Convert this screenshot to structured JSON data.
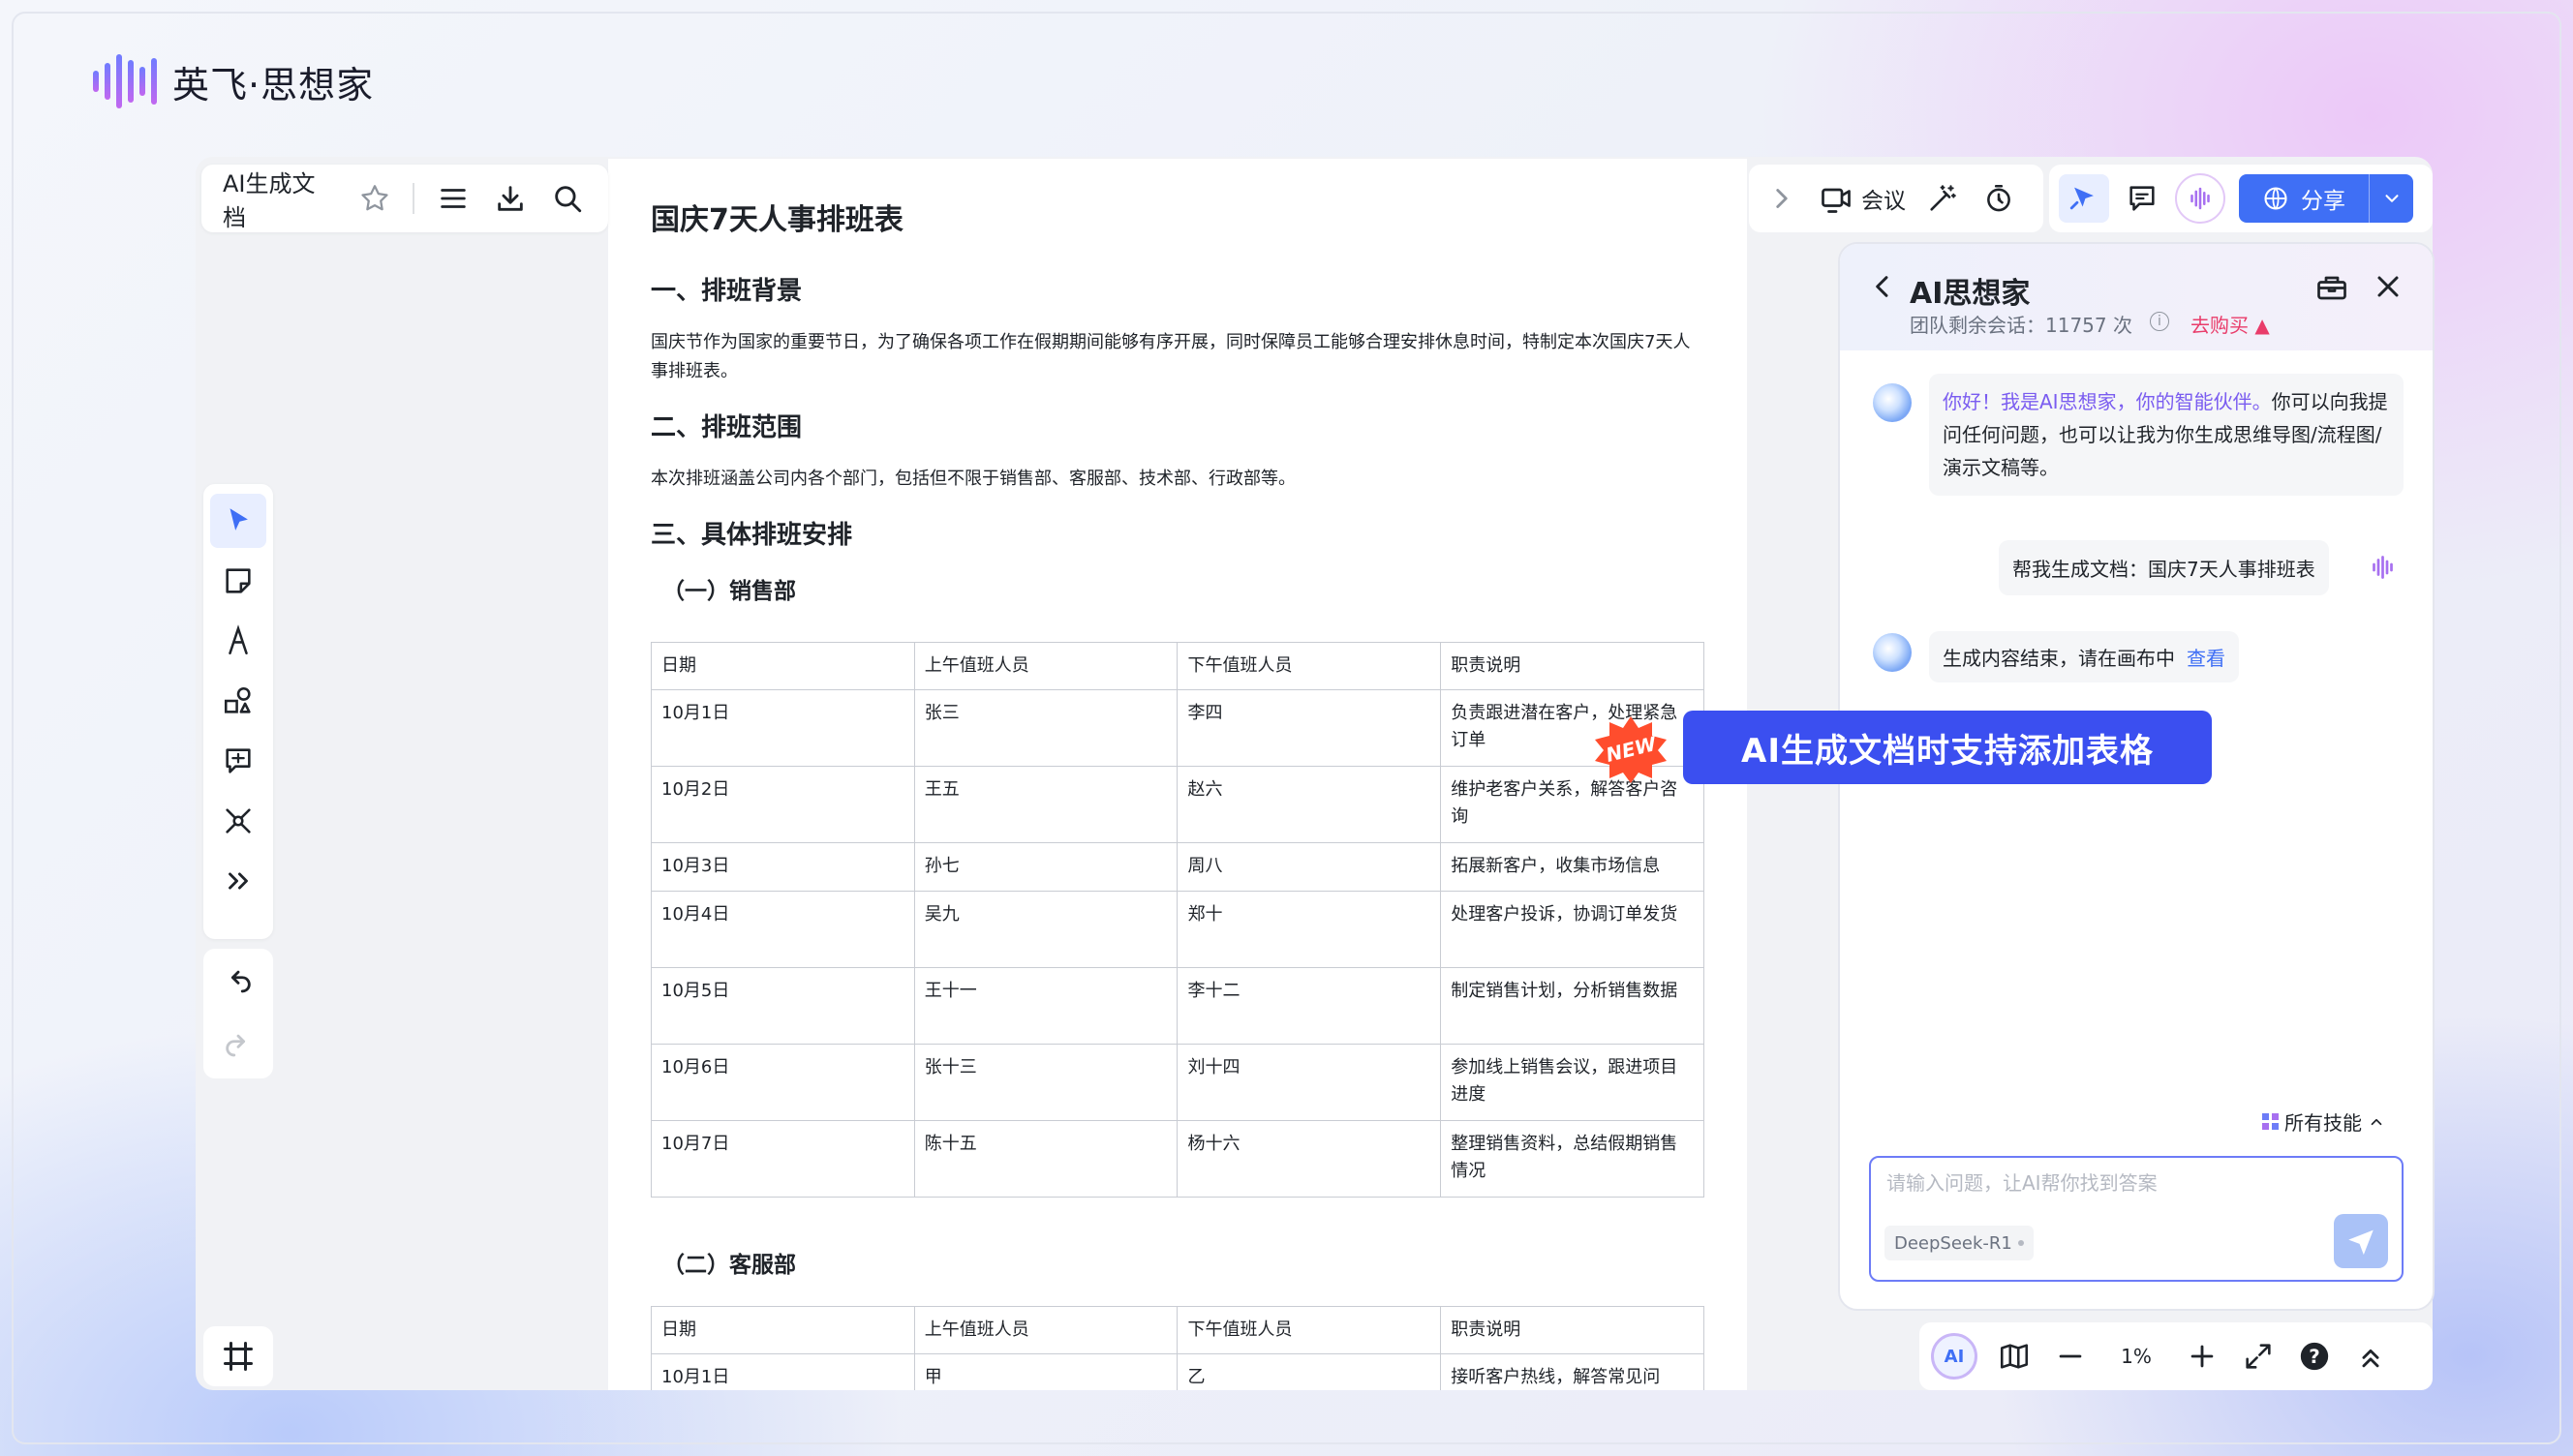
{
  "app": {
    "brand": "英飞·思想家"
  },
  "toolbar_left": {
    "title": "AI生成文档"
  },
  "toolbar_right": {
    "meeting_label": "会议",
    "share_label": "分享"
  },
  "document": {
    "title": "国庆7天人事排班表",
    "sections": [
      {
        "heading": "一、排班背景",
        "body": "国庆节作为国家的重要节日，为了确保各项工作在假期期间能够有序开展，同时保障员工能够合理安排休息时间，特制定本次国庆7天人事排班表。"
      },
      {
        "heading": "二、排班范围",
        "body": "本次排班涵盖公司内各个部门，包括但不限于销售部、客服部、技术部、行政部等。"
      },
      {
        "heading": "三、具体排班安排"
      }
    ],
    "sub1": "（一）销售部",
    "sub2": "（二）客服部",
    "table_headers": [
      "日期",
      "上午值班人员",
      "下午值班人员",
      "职责说明"
    ],
    "sales_rows": [
      [
        "10月1日",
        "张三",
        "李四",
        "负责跟进潜在客户，处理紧急订单"
      ],
      [
        "10月2日",
        "王五",
        "赵六",
        "维护老客户关系，解答客户咨询"
      ],
      [
        "10月3日",
        "孙七",
        "周八",
        "拓展新客户，收集市场信息"
      ],
      [
        "10月4日",
        "吴九",
        "郑十",
        "处理客户投诉，协调订单发货"
      ],
      [
        "10月5日",
        "王十一",
        "李十二",
        "制定销售计划，分析销售数据"
      ],
      [
        "10月6日",
        "张十三",
        "刘十四",
        "参加线上销售会议，跟进项目进度"
      ],
      [
        "10月7日",
        "陈十五",
        "杨十六",
        "整理销售资料，总结假期销售情况"
      ]
    ],
    "service_rows": [
      [
        "10月1日",
        "甲",
        "乙",
        "接听客户热线，解答常见问"
      ]
    ]
  },
  "ai_panel": {
    "title": "AI思想家",
    "quota_label": "团队剩余会话：11757 次",
    "buy_label": "去购买",
    "greeting_highlight": "你好！我是AI思想家，你的智能伙伴。",
    "greeting_rest": "你可以向我提问任何问题，也可以让我为你生成思维导图/流程图/演示文稿等。",
    "user_message": "帮我生成文档：国庆7天人事排班表",
    "done_message": "生成内容结束，请在画布中",
    "view_link": "查看",
    "skills_label": "所有技能",
    "input_placeholder": "请输入问题，让AI帮你找到答案",
    "model": "DeepSeek-R1"
  },
  "bottom_bar": {
    "zoom": "1%",
    "ai_badge": "AI"
  },
  "callout": {
    "text": "AI生成文档时支持添加表格",
    "badge": "NEW"
  },
  "colors": {
    "accent": "#3f6ff5",
    "callout": "#3b4ff0",
    "badge": "#ff4d2d",
    "highlight": "#7a5cf0"
  }
}
